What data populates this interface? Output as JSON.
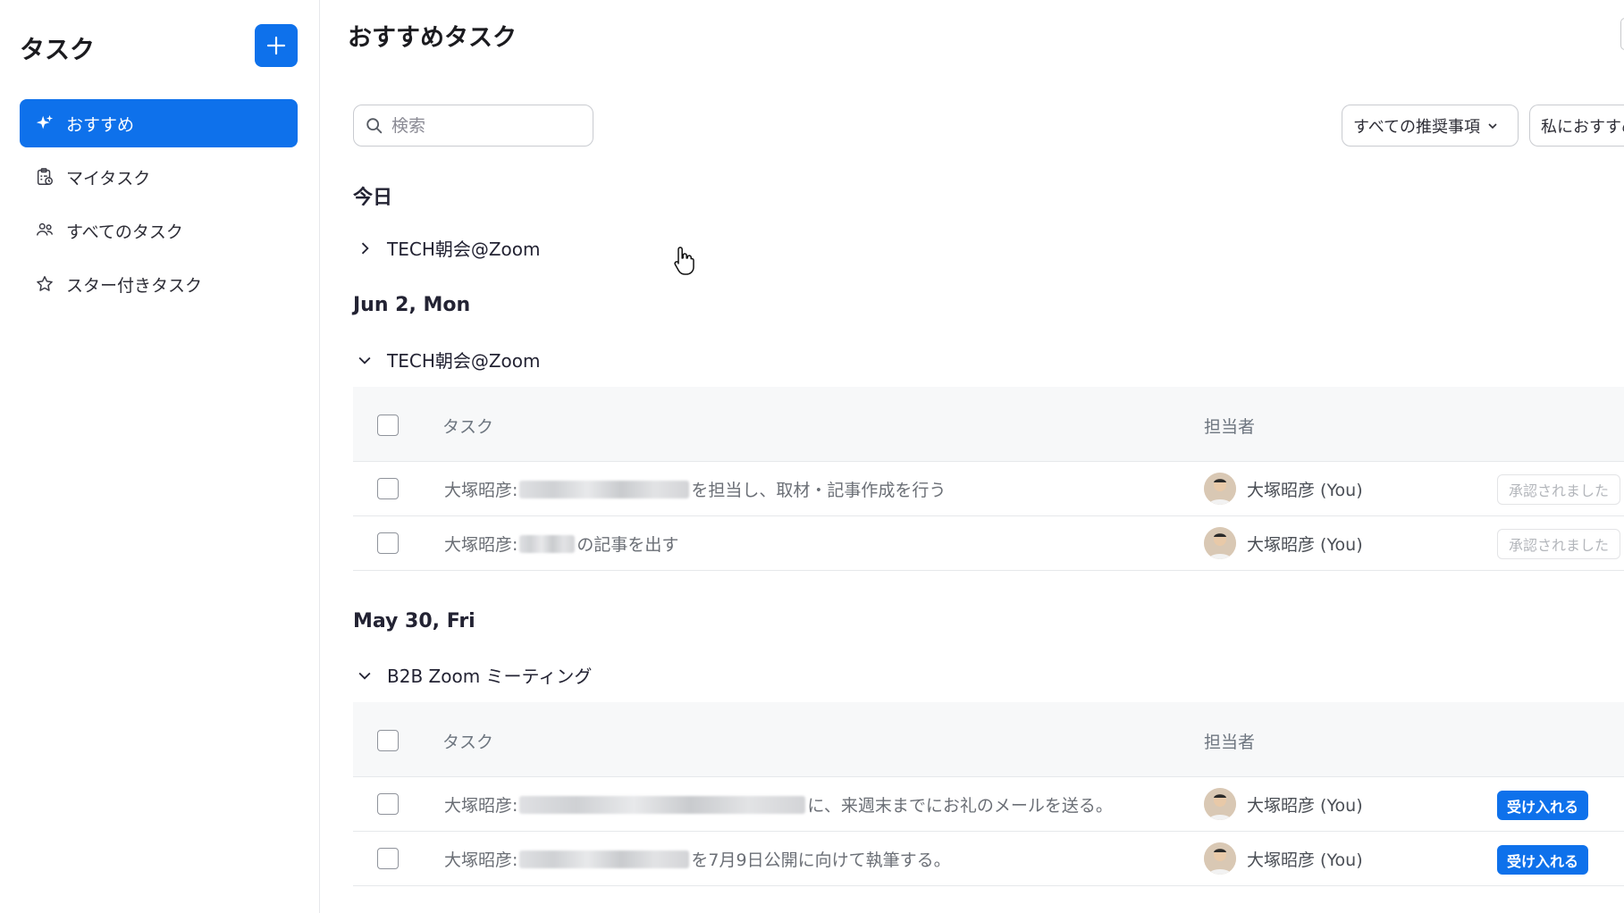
{
  "sidebar": {
    "title": "タスク",
    "new_button_icon": "plus-icon",
    "items": [
      {
        "label": "おすすめ",
        "icon": "sparkle-icon",
        "active": true
      },
      {
        "label": "マイタスク",
        "icon": "clipboard-icon",
        "active": false
      },
      {
        "label": "すべてのタスク",
        "icon": "people-icon",
        "active": false
      },
      {
        "label": "スター付きタスク",
        "icon": "star-icon",
        "active": false
      }
    ]
  },
  "main": {
    "title": "おすすめタスク",
    "search": {
      "placeholder": "検索",
      "value": ""
    },
    "filters": [
      {
        "label": "すべての推奨事項"
      },
      {
        "label": "私におすすめ"
      }
    ],
    "today": {
      "heading": "今日",
      "groups": [
        {
          "name": "TECH朝会@Zoom",
          "expanded": false
        }
      ]
    },
    "sections": [
      {
        "date": "Jun 2, Mon",
        "group": "TECH朝会@Zoom",
        "expanded": true,
        "header": {
          "task": "タスク",
          "owner": "担当者"
        },
        "rows": [
          {
            "prefix": "大塚昭彦:",
            "suffix": "を担当し、取材・記事作成を行う",
            "owner": "大塚昭彦 (You)",
            "status": "承認されました"
          },
          {
            "prefix": "大塚昭彦:",
            "suffix": "の記事を出す",
            "owner": "大塚昭彦 (You)",
            "status": "承認されました"
          }
        ]
      },
      {
        "date": "May 30, Fri",
        "group": "B2B Zoom ミーティング",
        "expanded": true,
        "header": {
          "task": "タスク",
          "owner": "担当者"
        },
        "rows": [
          {
            "prefix": "大塚昭彦:",
            "suffix": "に、来週末までにお礼のメールを送る。",
            "owner": "大塚昭彦 (You)",
            "action": "受け入れる"
          },
          {
            "prefix": "大塚昭彦:",
            "suffix": "を7月9日公開に向けて執筆する。",
            "owner": "大塚昭彦 (You)",
            "action": "受け入れる"
          }
        ]
      }
    ]
  },
  "colors": {
    "accent": "#0e71eb",
    "text": "#232333",
    "muted": "#6e7680",
    "header_bg": "#f7f8f9"
  }
}
